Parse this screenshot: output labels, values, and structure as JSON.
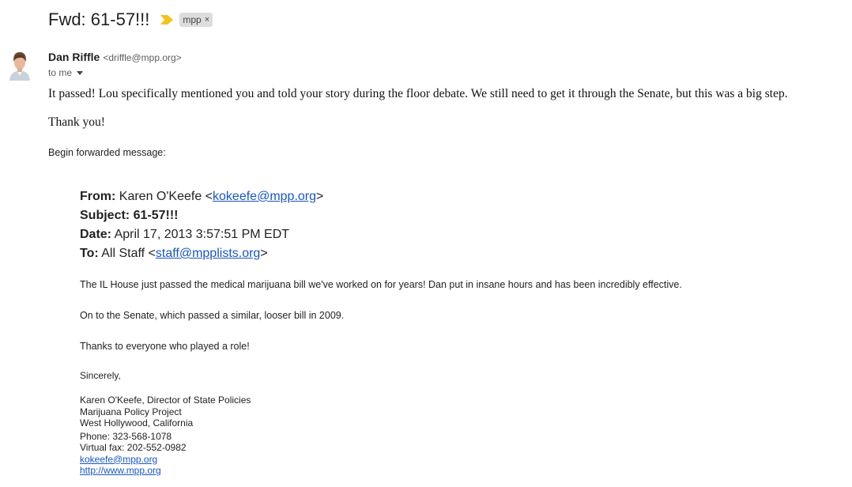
{
  "email": {
    "subject": "Fwd: 61-57!!!",
    "label": "mpp",
    "label_remove": "×",
    "sender_name": "Dan Riffle",
    "sender_email": "<driffle@mpp.org>",
    "recipient": "to me",
    "body_p1": "It passed! Lou specifically mentioned you and told your story during the floor debate. We still need to get it through the Senate, but this was a big step.",
    "body_p2": "Thank you!",
    "begin_forwarded": "Begin forwarded message:"
  },
  "forwarded": {
    "from_label": "From:",
    "from_name": "Karen O'Keefe <",
    "from_email": "kokeefe@mpp.org",
    "from_close": ">",
    "subject_label": "Subject:",
    "subject_value": "61-57!!!",
    "date_label": "Date:",
    "date_value": "April 17, 2013 3:57:51 PM EDT",
    "to_label": "To:",
    "to_name": "All Staff <",
    "to_email": "staff@mpplists.org",
    "to_close": ">",
    "p1": "The IL House just passed the medical marijuana bill we've worked on for years! Dan put in insane hours and has been incredibly effective.",
    "p2": "On to the Senate, which passed a similar, looser bill in 2009.",
    "p3": "Thanks to everyone who played a role!",
    "closing": "Sincerely,",
    "sig_name": "Karen O'Keefe, Director of State Policies",
    "sig_org": "Marijuana Policy Project",
    "sig_location": "West Hollywood, California",
    "sig_phone": "Phone:  323-568-1078",
    "sig_fax": "Virtual fax: 202-552-0982",
    "sig_email": "kokeefe@mpp.org",
    "sig_url": "http://www.mpp.org"
  },
  "colors": {
    "link": "#1a56c4",
    "importance": "#f2c318",
    "label_bg": "#dddddd"
  }
}
